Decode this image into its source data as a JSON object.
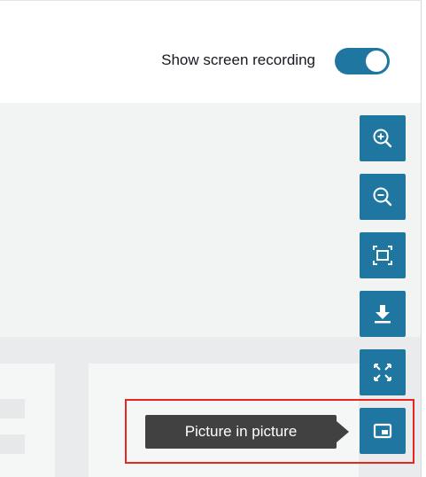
{
  "header": {
    "toggle_label": "Show screen recording",
    "toggle_on": true
  },
  "toolbar": {
    "buttons": [
      {
        "name": "zoom-in",
        "icon": "zoom-in-icon"
      },
      {
        "name": "zoom-out",
        "icon": "zoom-out-icon"
      },
      {
        "name": "fit-to-screen",
        "icon": "fit-screen-icon"
      },
      {
        "name": "download",
        "icon": "download-icon"
      },
      {
        "name": "fullscreen",
        "icon": "expand-arrows-icon"
      },
      {
        "name": "picture-in-picture",
        "icon": "picture-in-picture-icon"
      }
    ]
  },
  "tooltip": {
    "text": "Picture in picture"
  },
  "colors": {
    "accent": "#1f77a1",
    "tooltip_bg": "#414141",
    "highlight": "#e8261f"
  }
}
